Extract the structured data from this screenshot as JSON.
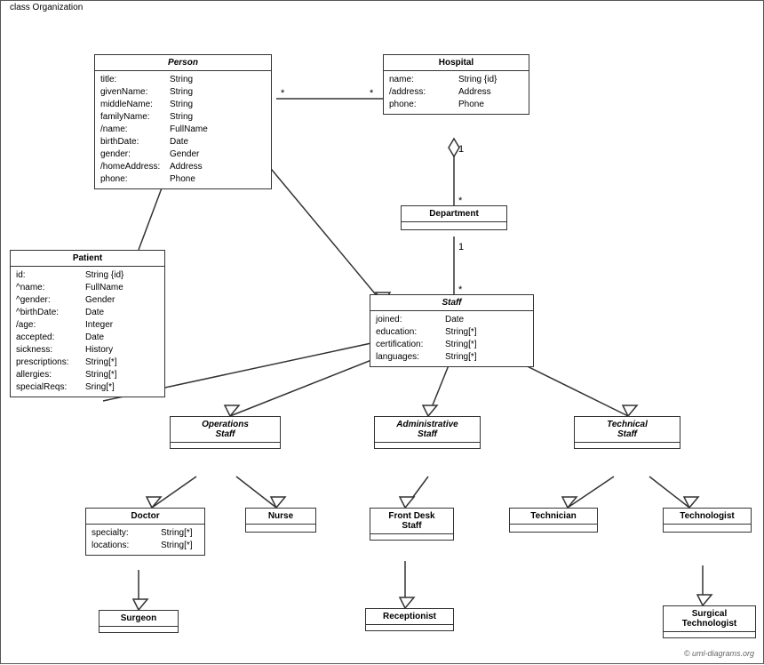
{
  "diagram": {
    "title": "class Organization",
    "classes": {
      "person": {
        "name": "Person",
        "italic": true,
        "attrs": [
          {
            "name": "title:",
            "type": "String"
          },
          {
            "name": "givenName:",
            "type": "String"
          },
          {
            "name": "middleName:",
            "type": "String"
          },
          {
            "name": "familyName:",
            "type": "String"
          },
          {
            "name": "/name:",
            "type": "FullName"
          },
          {
            "name": "birthDate:",
            "type": "Date"
          },
          {
            "name": "gender:",
            "type": "Gender"
          },
          {
            "name": "/homeAddress:",
            "type": "Address"
          },
          {
            "name": "phone:",
            "type": "Phone"
          }
        ]
      },
      "hospital": {
        "name": "Hospital",
        "italic": false,
        "attrs": [
          {
            "name": "name:",
            "type": "String {id}"
          },
          {
            "name": "/address:",
            "type": "Address"
          },
          {
            "name": "phone:",
            "type": "Phone"
          }
        ]
      },
      "patient": {
        "name": "Patient",
        "italic": false,
        "attrs": [
          {
            "name": "id:",
            "type": "String {id}"
          },
          {
            "name": "^name:",
            "type": "FullName"
          },
          {
            "name": "^gender:",
            "type": "Gender"
          },
          {
            "name": "^birthDate:",
            "type": "Date"
          },
          {
            "name": "/age:",
            "type": "Integer"
          },
          {
            "name": "accepted:",
            "type": "Date"
          },
          {
            "name": "sickness:",
            "type": "History"
          },
          {
            "name": "prescriptions:",
            "type": "String[*]"
          },
          {
            "name": "allergies:",
            "type": "String[*]"
          },
          {
            "name": "specialReqs:",
            "type": "Sring[*]"
          }
        ]
      },
      "department": {
        "name": "Department",
        "italic": false,
        "attrs": []
      },
      "staff": {
        "name": "Staff",
        "italic": true,
        "attrs": [
          {
            "name": "joined:",
            "type": "Date"
          },
          {
            "name": "education:",
            "type": "String[*]"
          },
          {
            "name": "certification:",
            "type": "String[*]"
          },
          {
            "name": "languages:",
            "type": "String[*]"
          }
        ]
      },
      "operations_staff": {
        "name": "Operations Staff",
        "italic": true
      },
      "admin_staff": {
        "name": "Administrative Staff",
        "italic": true
      },
      "technical_staff": {
        "name": "Technical Staff",
        "italic": true
      },
      "doctor": {
        "name": "Doctor",
        "italic": false,
        "attrs": [
          {
            "name": "specialty:",
            "type": "String[*]"
          },
          {
            "name": "locations:",
            "type": "String[*]"
          }
        ]
      },
      "nurse": {
        "name": "Nurse",
        "italic": false,
        "attrs": []
      },
      "front_desk": {
        "name": "Front Desk Staff",
        "italic": false,
        "attrs": []
      },
      "technician": {
        "name": "Technician",
        "italic": false,
        "attrs": []
      },
      "technologist": {
        "name": "Technologist",
        "italic": false,
        "attrs": []
      },
      "surgeon": {
        "name": "Surgeon",
        "italic": false,
        "attrs": []
      },
      "receptionist": {
        "name": "Receptionist",
        "italic": false,
        "attrs": []
      },
      "surgical_technologist": {
        "name": "Surgical Technologist",
        "italic": false,
        "attrs": []
      }
    },
    "copyright": "© uml-diagrams.org"
  }
}
